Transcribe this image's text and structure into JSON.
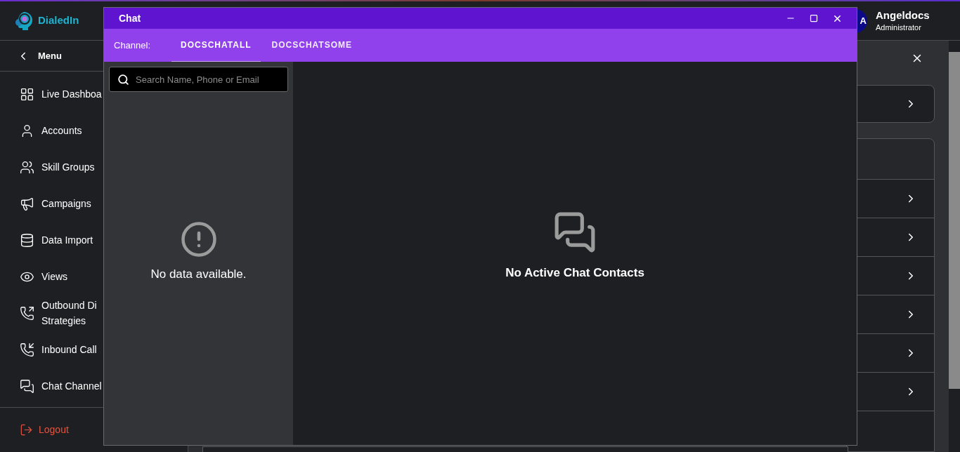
{
  "app": {
    "logo": "DialedIn",
    "user": {
      "initial": "A",
      "name": "Angeldocs",
      "role": "Administrator"
    }
  },
  "sidebar": {
    "back_label": "Menu",
    "items": [
      {
        "lines": [
          "Live Dashboa"
        ]
      },
      {
        "lines": [
          "Accounts"
        ]
      },
      {
        "lines": [
          "Skill Groups"
        ]
      },
      {
        "lines": [
          "Campaigns"
        ]
      },
      {
        "lines": [
          "Data Import"
        ]
      },
      {
        "lines": [
          "Views"
        ]
      },
      {
        "lines": [
          "Outbound Di",
          "Strategies"
        ]
      },
      {
        "lines": [
          "Inbound Call"
        ]
      },
      {
        "lines": [
          "Chat Channel"
        ]
      }
    ],
    "logout": "Logout"
  },
  "chat_window": {
    "title": "Chat",
    "channel_label": "Channel:",
    "tabs": [
      {
        "label": "DOCSCHATALL",
        "selected": true
      },
      {
        "label": "DOCSCHATSOME",
        "selected": false
      }
    ],
    "search": {
      "placeholder": "Search Name, Phone or Email"
    },
    "contacts_empty": "No data available.",
    "conversation_empty": "No Active Chat Contacts"
  }
}
